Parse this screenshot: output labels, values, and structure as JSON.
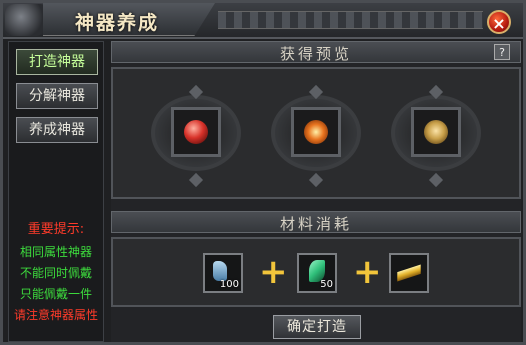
{
  "window": {
    "title": "神器养成",
    "close_label": "×"
  },
  "sidebar": {
    "items": [
      {
        "label": "打造神器",
        "active": true
      },
      {
        "label": "分解神器",
        "active": false
      },
      {
        "label": "养成神器",
        "active": false
      }
    ],
    "tips": {
      "title": "重要提示:",
      "lines": [
        {
          "text": "相同属性神器",
          "color": "#3ddc3d"
        },
        {
          "text": "不能同时佩戴",
          "color": "#3ddc3d"
        },
        {
          "text": "只能佩戴一件",
          "color": "#3ddc3d"
        },
        {
          "text": "请注意神器属性",
          "color": "#ff3b2a"
        }
      ]
    }
  },
  "preview": {
    "header": "获得预览",
    "help_label": "?",
    "items": [
      {
        "icon": "red-crystal-artifact-icon",
        "color": "#d8322a"
      },
      {
        "icon": "orange-gear-artifact-icon",
        "color": "#e8741f"
      },
      {
        "icon": "gold-ring-artifact-icon",
        "color": "#c9a04a"
      }
    ]
  },
  "materials": {
    "header": "材料消耗",
    "items": [
      {
        "icon": "blue-ore-icon",
        "count": "100",
        "color": "#6fa3c8"
      },
      {
        "icon": "green-jade-icon",
        "count": "50",
        "color": "#2fbf7a"
      },
      {
        "icon": "gold-bar-icon",
        "count": "",
        "color": "#e3b22b"
      }
    ],
    "plus_symbol": "+"
  },
  "confirm_button": "确定打造"
}
